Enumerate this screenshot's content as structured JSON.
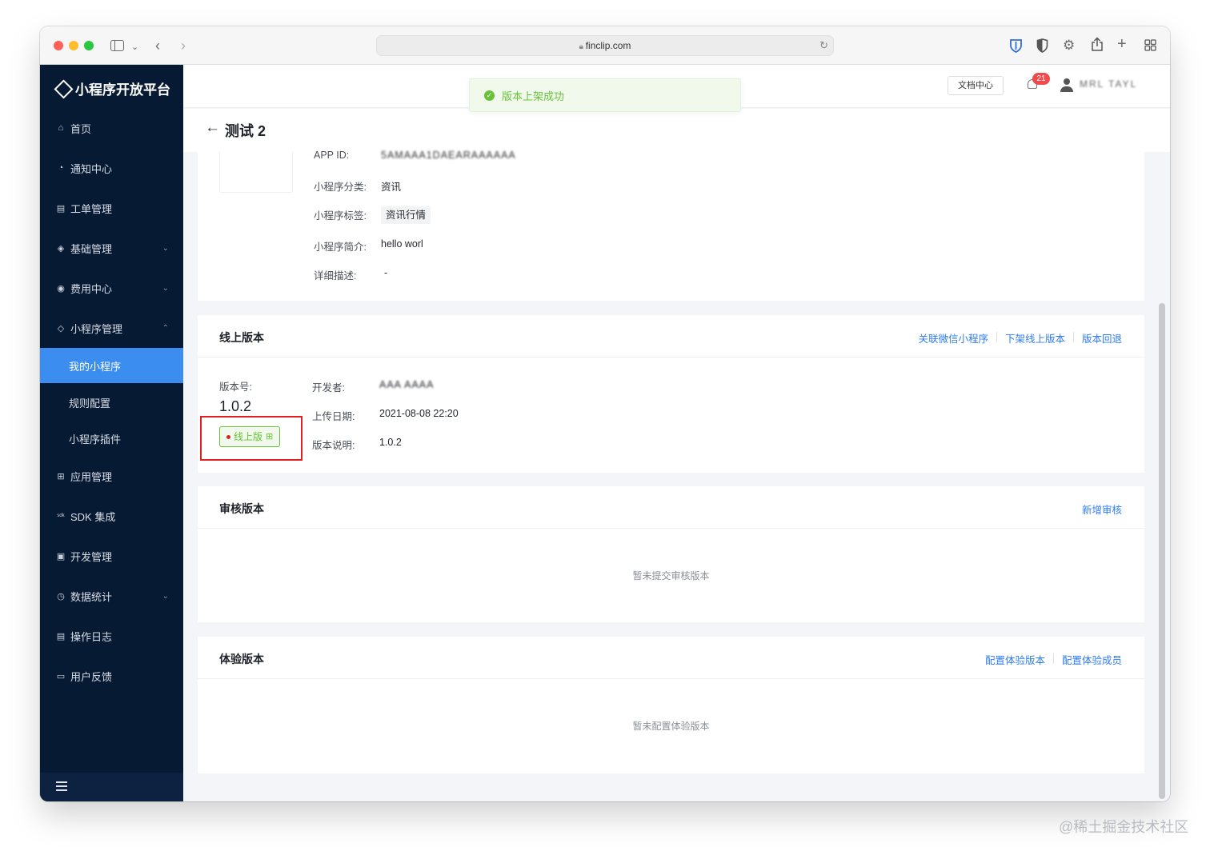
{
  "browser": {
    "url": "finclip.com",
    "icons": [
      "sidebar-toggle-icon",
      "chevron-down-icon",
      "back-icon",
      "forward-icon",
      "lock-icon",
      "reload-icon",
      "bitwarden-shield-icon",
      "privacy-shield-icon",
      "gear-icon",
      "share-icon",
      "new-tab-icon",
      "tab-overview-icon"
    ]
  },
  "sidebar": {
    "logo_text": "小程序开放平台",
    "items": [
      {
        "label": "首页",
        "icon": "⌂"
      },
      {
        "label": "通知中心",
        "icon": "◔"
      },
      {
        "label": "工单管理",
        "icon": "▤"
      },
      {
        "label": "基础管理",
        "icon": "◈",
        "chevron": "⌄"
      },
      {
        "label": "费用中心",
        "icon": "◉",
        "chevron": "⌄"
      },
      {
        "label": "小程序管理",
        "icon": "◇",
        "chevron": "⌃"
      },
      {
        "label": "应用管理",
        "icon": "⊞"
      },
      {
        "label": "SDK 集成",
        "icon": "sdk"
      },
      {
        "label": "开发管理",
        "icon": "▣"
      },
      {
        "label": "数据统计",
        "icon": "◷",
        "chevron": "⌄"
      },
      {
        "label": "操作日志",
        "icon": "▤"
      },
      {
        "label": "用户反馈",
        "icon": "▭"
      }
    ],
    "sub_items": [
      {
        "label": "我的小程序",
        "active": true
      },
      {
        "label": "规则配置"
      },
      {
        "label": "小程序插件"
      }
    ]
  },
  "header": {
    "docs_label": "文档中心",
    "notification_count": "21",
    "user_name": "MRL TAYL"
  },
  "toast": {
    "text": "版本上架成功",
    "icon": "✓"
  },
  "page": {
    "back_icon": "←",
    "title": "测试 2"
  },
  "app_info": {
    "app_id_label": "APP ID:",
    "app_id_value": "5AMAAA1DAEARAAAAAA",
    "category_label": "小程序分类:",
    "category_value": "资讯",
    "tag_label": "小程序标签:",
    "tag_value": "资讯行情",
    "intro_label": "小程序简介:",
    "intro_value": "hello worl",
    "desc_label": "详细描述:",
    "desc_value": "-"
  },
  "online_version": {
    "title": "线上版本",
    "links": [
      "关联微信小程序",
      "下架线上版本",
      "版本回退"
    ],
    "version_label": "版本号:",
    "version_number": "1.0.2",
    "badge_text": "线上版",
    "badge_qr": "⊞",
    "developer_label": "开发者:",
    "developer_value": "AAA AAAA",
    "upload_date_label": "上传日期:",
    "upload_date_value": "2021-08-08 22:20",
    "note_label": "版本说明:",
    "note_value": "1.0.2"
  },
  "review_version": {
    "title": "审核版本",
    "link": "新增审核",
    "empty": "暂未提交审核版本"
  },
  "trial_version": {
    "title": "体验版本",
    "links": [
      "配置体验版本",
      "配置体验成员"
    ],
    "empty": "暂未配置体验版本"
  },
  "watermark": "@稀土掘金技术社区",
  "colors": {
    "sidebar_bg": "#071a33",
    "accent": "#3b8ef0",
    "link": "#2f7cf6",
    "success": "#67c23a",
    "highlight": "#e02020"
  }
}
